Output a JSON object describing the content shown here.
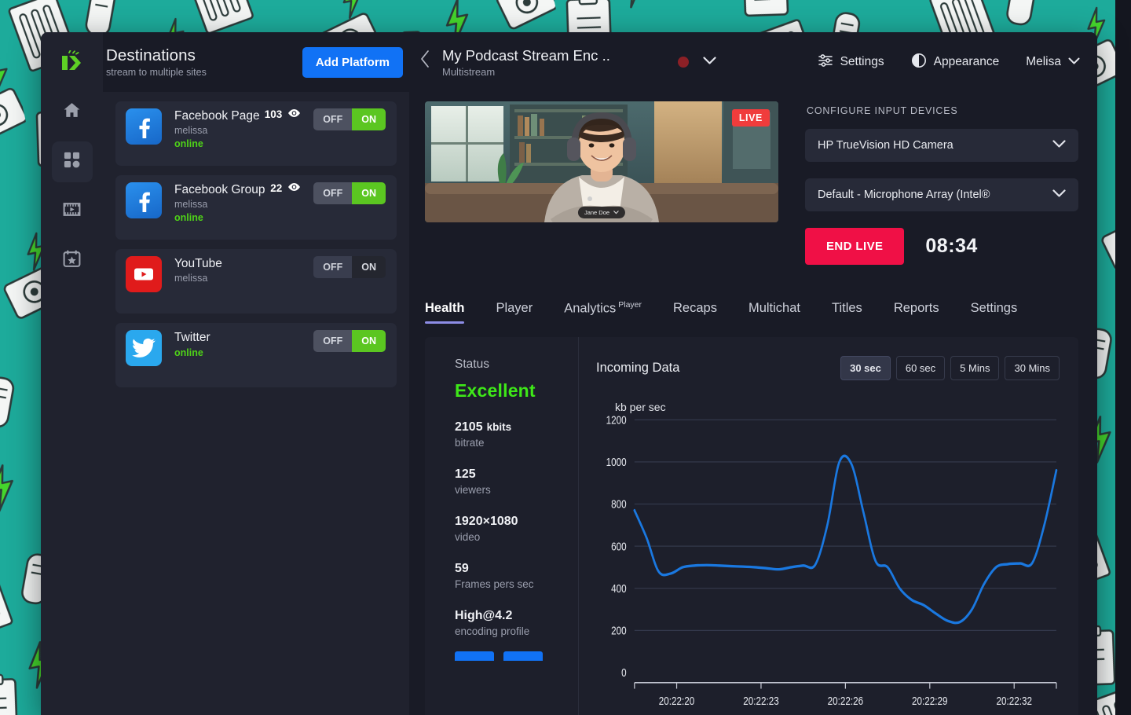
{
  "window": {
    "brand_logo_icon": "restream-logo-icon"
  },
  "sidebar": {
    "items": [
      {
        "name": "home",
        "icon": "home-icon",
        "active": false
      },
      {
        "name": "dashboard",
        "icon": "grid-icon",
        "active": true
      },
      {
        "name": "videos",
        "icon": "film-icon",
        "active": false
      },
      {
        "name": "events",
        "icon": "calendar-star-icon",
        "active": false
      }
    ]
  },
  "destinations_header": {
    "title": "Destinations",
    "subtitle": "stream to multiple sites",
    "add_button_label": "Add Platform"
  },
  "stream_header": {
    "back_icon": "chevron-left-icon",
    "name": "My Podcast Stream Enc  ..",
    "type": "Multistream",
    "record_dot_color": "#8c2026",
    "dropdown_icon": "chevron-down-icon",
    "actions": [
      {
        "label": "Settings",
        "icon": "sliders-icon"
      },
      {
        "label": "Appearance",
        "icon": "moon-icon"
      }
    ],
    "user": {
      "label": "Melisa",
      "icon": "chevron-down-icon"
    }
  },
  "destinations": [
    {
      "platform": "Facebook Page",
      "icon": "facebook-icon",
      "username": "melissa",
      "status": "online",
      "viewers": "103",
      "viewers_icon": "eye-icon",
      "toggle": {
        "off_label": "OFF",
        "on_label": "ON",
        "state": "on"
      }
    },
    {
      "platform": "Facebook Group",
      "icon": "facebook-icon",
      "username": "melissa",
      "status": "online",
      "viewers": "22",
      "viewers_icon": "eye-icon",
      "toggle": {
        "off_label": "OFF",
        "on_label": "ON",
        "state": "on"
      }
    },
    {
      "platform": "YouTube",
      "icon": "youtube-icon",
      "username": "melissa",
      "status": "",
      "viewers": "",
      "viewers_icon": "",
      "toggle": {
        "off_label": "OFF",
        "on_label": "ON",
        "state": "off"
      }
    },
    {
      "platform": "Twitter",
      "icon": "twitter-icon",
      "username": "",
      "status": "online",
      "viewers": "",
      "viewers_icon": "",
      "toggle": {
        "off_label": "OFF",
        "on_label": "ON",
        "state": "on"
      }
    }
  ],
  "video": {
    "live_badge": "LIVE",
    "name_tag": "Jane Doe",
    "name_tag_icon": "chevron-down-icon"
  },
  "devices": {
    "title": "CONFIGURE INPUT DEVICES",
    "camera": {
      "value": "HP TrueVision HD Camera",
      "icon": "chevron-down-icon"
    },
    "microphone": {
      "value": "Default - Microphone Array (Intel®",
      "icon": "chevron-down-icon"
    },
    "end_live_label": "END LIVE",
    "timer": "08:34"
  },
  "tabs": [
    {
      "label": "Health",
      "sup": "",
      "active": true
    },
    {
      "label": "Player",
      "sup": "",
      "active": false
    },
    {
      "label": "Analytics",
      "sup": "Player",
      "active": false
    },
    {
      "label": "Recaps",
      "sup": "",
      "active": false
    },
    {
      "label": "Multichat",
      "sup": "",
      "active": false
    },
    {
      "label": "Titles",
      "sup": "",
      "active": false
    },
    {
      "label": "Reports",
      "sup": "",
      "active": false
    },
    {
      "label": "Settings",
      "sup": "",
      "active": false
    }
  ],
  "health": {
    "status_label": "Status",
    "status_value": "Excellent",
    "status_color": "#3ee818",
    "stats": [
      {
        "value": "2105",
        "unit": "kbits",
        "key": "bitrate"
      },
      {
        "value": "125",
        "unit": "",
        "key": "viewers"
      },
      {
        "value": "1920×1080",
        "unit": "",
        "key": "video"
      },
      {
        "value": "59",
        "unit": "",
        "key": "Frames pers sec"
      },
      {
        "value": "High@4.2",
        "unit": "",
        "key": "encoding profile"
      }
    ]
  },
  "chart_panel": {
    "title": "Incoming Data",
    "ranges": [
      {
        "label": "30 sec",
        "active": true
      },
      {
        "label": "60 sec",
        "active": false
      },
      {
        "label": "5 Mins",
        "active": false
      },
      {
        "label": "30 Mins",
        "active": false
      }
    ]
  },
  "chart_data": {
    "type": "line",
    "title": "Incoming Data",
    "xlabel": "",
    "ylabel": "kb per sec",
    "ylim": [
      0,
      1200
    ],
    "yticks": [
      0,
      200,
      400,
      600,
      800,
      1000,
      1200
    ],
    "xticks": [
      "20:22:20",
      "20:22:23",
      "20:22:26",
      "20:22:29",
      "20:22:32"
    ],
    "grid": true,
    "legend": "none",
    "series": [
      {
        "name": "kb per sec",
        "color": "#1a78e0",
        "x": [
          0,
          1,
          2,
          3,
          4,
          5,
          6,
          7,
          8,
          9,
          10,
          11,
          12,
          13,
          14,
          15,
          16,
          17,
          18,
          19,
          20,
          21,
          22,
          23,
          24,
          25,
          26,
          27,
          28,
          29
        ],
        "values": [
          770,
          640,
          480,
          470,
          500,
          508,
          510,
          508,
          505,
          503,
          500,
          495,
          490,
          500,
          508,
          512,
          700,
          1000,
          990,
          760,
          530,
          500,
          400,
          345,
          320,
          280,
          245,
          240,
          300,
          420,
          500,
          515,
          518,
          520,
          700,
          960
        ]
      }
    ]
  }
}
